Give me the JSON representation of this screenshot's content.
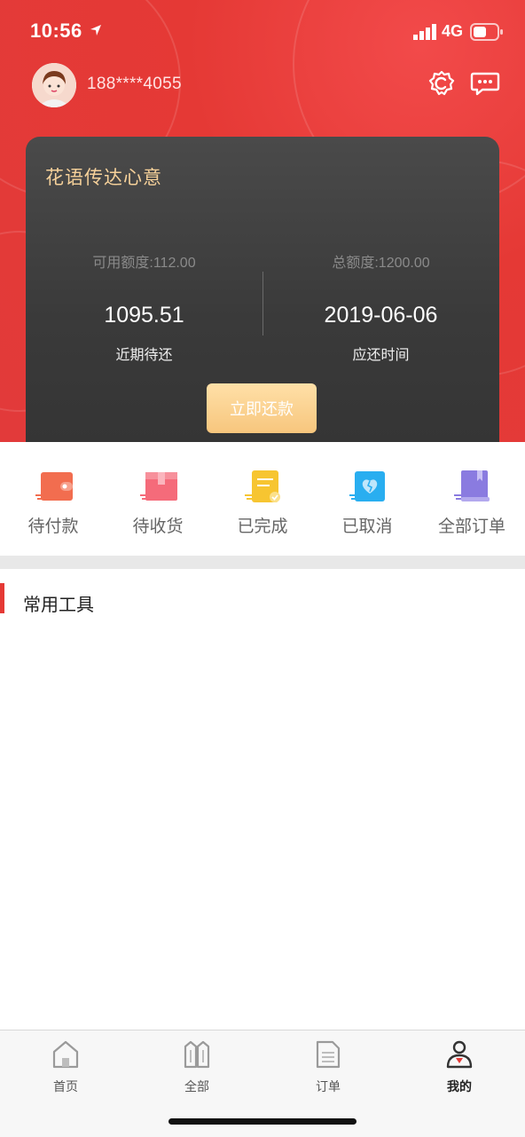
{
  "status_bar": {
    "time": "10:56",
    "network": "4G"
  },
  "profile": {
    "phone": "188****4055"
  },
  "card": {
    "title": "花语传达心意",
    "left": {
      "sub": "可用额度:112.00",
      "value": "1095.51",
      "caption": "近期待还"
    },
    "right": {
      "sub": "总额度:1200.00",
      "value": "2019-06-06",
      "caption": "应还时间"
    },
    "button": "立即还款"
  },
  "orders": [
    {
      "label": "待付款",
      "icon": "wallet-icon",
      "color": "#f26d4f"
    },
    {
      "label": "待收货",
      "icon": "package-icon",
      "color": "#f56b7a"
    },
    {
      "label": "已完成",
      "icon": "document-check-icon",
      "color": "#f7c531"
    },
    {
      "label": "已取消",
      "icon": "broken-heart-icon",
      "color": "#29aef0"
    },
    {
      "label": "全部订单",
      "icon": "book-icon",
      "color": "#8a7be0"
    }
  ],
  "tools": {
    "title": "常用工具"
  },
  "tabbar": [
    {
      "label": "首页",
      "icon": "home-icon"
    },
    {
      "label": "全部",
      "icon": "grid-icon"
    },
    {
      "label": "订单",
      "icon": "document-icon"
    },
    {
      "label": "我的",
      "icon": "user-icon",
      "active": true
    }
  ]
}
